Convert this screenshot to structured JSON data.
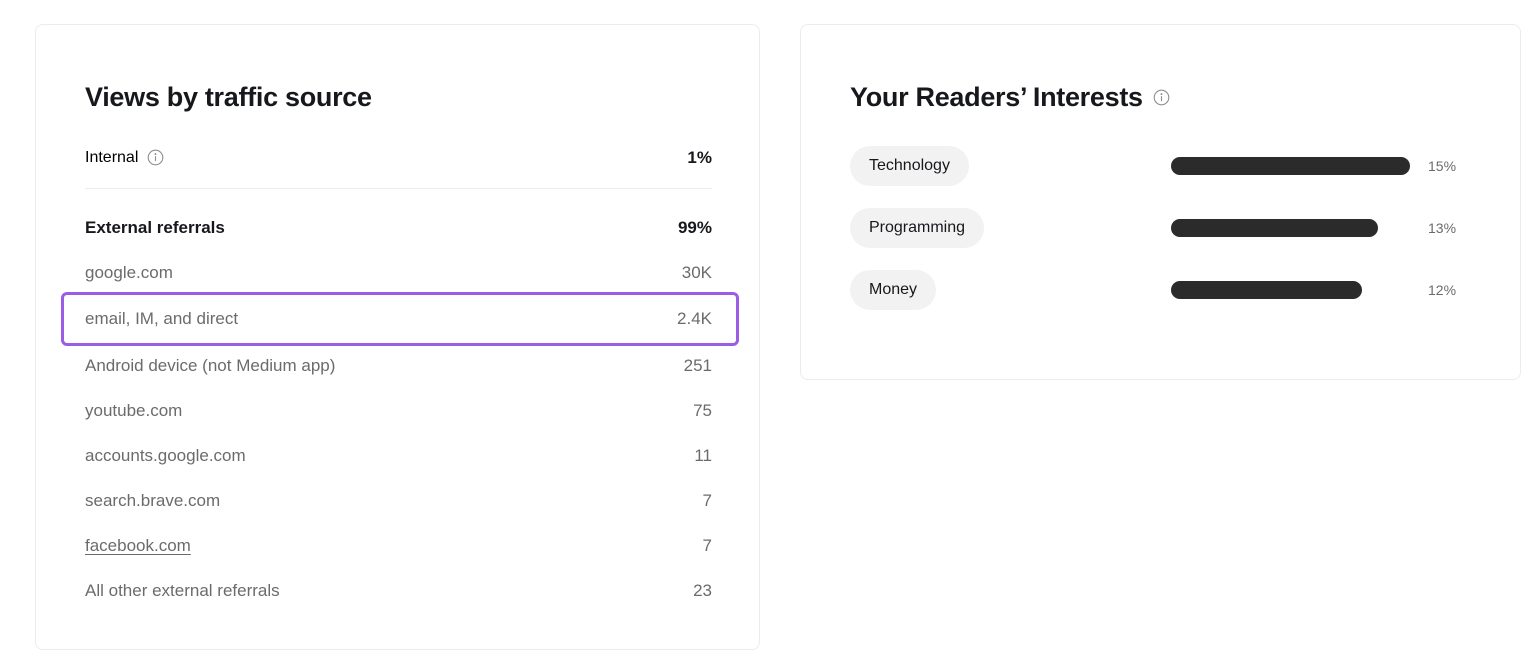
{
  "traffic_card": {
    "title": "Views by traffic source",
    "internal": {
      "label": "Internal",
      "value": "1%",
      "info_icon": "info-circle-icon"
    },
    "external": {
      "label": "External referrals",
      "value": "99%"
    },
    "sources": [
      {
        "label": "google.com",
        "value": "30K",
        "link": false,
        "highlighted": false
      },
      {
        "label": "email, IM, and direct",
        "value": "2.4K",
        "link": false,
        "highlighted": true
      },
      {
        "label": "Android device (not Medium app)",
        "value": "251",
        "link": false,
        "highlighted": false
      },
      {
        "label": "youtube.com",
        "value": "75",
        "link": false,
        "highlighted": false
      },
      {
        "label": "accounts.google.com",
        "value": "11",
        "link": false,
        "highlighted": false
      },
      {
        "label": "search.brave.com",
        "value": "7",
        "link": false,
        "highlighted": false
      },
      {
        "label": "facebook.com",
        "value": "7",
        "link": true,
        "highlighted": false
      },
      {
        "label": "All other external referrals",
        "value": "23",
        "link": false,
        "highlighted": false
      }
    ]
  },
  "interests_card": {
    "title": "Your Readers’ Interests",
    "info_icon": "info-circle-icon"
  },
  "colors": {
    "highlight": "#9b5de5",
    "bar": "#2b2b2b",
    "chip_bg": "#f2f2f2",
    "card_border": "#ececec",
    "text_primary": "#16181c",
    "text_secondary": "#6b6b6b"
  },
  "chart_data": {
    "type": "bar",
    "title": "Your Readers’ Interests",
    "orientation": "horizontal",
    "categories": [
      "Technology",
      "Programming",
      "Money"
    ],
    "values": [
      15,
      13,
      12
    ],
    "value_labels": [
      "15%",
      "13%",
      "12%"
    ],
    "xlabel": "",
    "ylabel": "",
    "xlim": [
      0,
      15.4
    ],
    "grid": false,
    "legend": false
  }
}
